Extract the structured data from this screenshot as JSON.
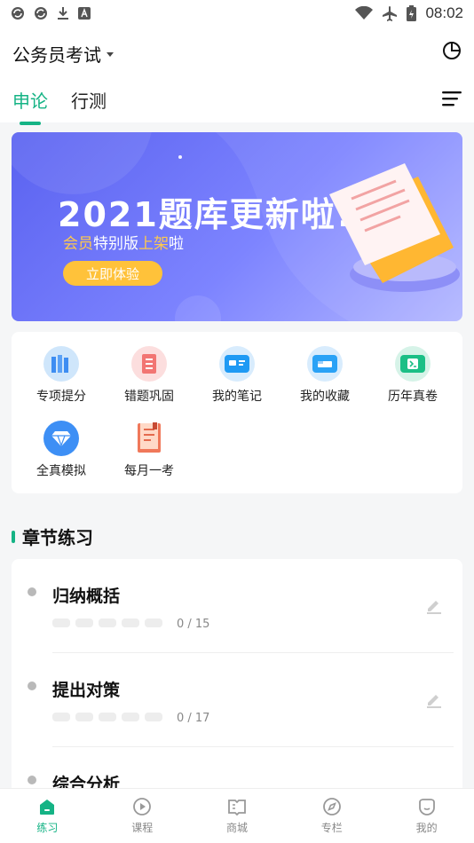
{
  "status_bar": {
    "time": "08:02",
    "icons_left": [
      "sync-icon",
      "sync-icon",
      "download-icon",
      "a-icon"
    ],
    "icons_right": [
      "wifi-icon",
      "airplane-icon",
      "battery-icon"
    ]
  },
  "header": {
    "exam_title": "公务员考试",
    "tabs": [
      {
        "label": "申论",
        "active": true
      },
      {
        "label": "行测",
        "active": false
      }
    ]
  },
  "banner": {
    "title": "2021题库更新啦!",
    "subtitle_parts": [
      "会员",
      "特别版",
      "上架",
      "啦"
    ],
    "cta": "立即体验"
  },
  "grid": {
    "items": [
      {
        "label": "专项提分",
        "icon": "books-icon"
      },
      {
        "label": "错题巩固",
        "icon": "error-book-icon"
      },
      {
        "label": "我的笔记",
        "icon": "notes-icon"
      },
      {
        "label": "我的收藏",
        "icon": "favorites-icon"
      },
      {
        "label": "历年真卷",
        "icon": "past-papers-icon"
      },
      {
        "label": "全真模拟",
        "icon": "diamond-icon"
      },
      {
        "label": "每月一考",
        "icon": "monthly-book-icon"
      }
    ]
  },
  "section": {
    "title": "章节练习"
  },
  "chapters": [
    {
      "name": "归纳概括",
      "count": "0 / 15",
      "progress": 0
    },
    {
      "name": "提出对策",
      "count": "0 / 17",
      "progress": 0
    },
    {
      "name": "综合分析",
      "count": "",
      "progress": 0
    }
  ],
  "tabbar": {
    "items": [
      {
        "label": "练习",
        "icon": "home-icon",
        "active": true
      },
      {
        "label": "课程",
        "icon": "play-icon",
        "active": false
      },
      {
        "label": "商城",
        "icon": "store-book-icon",
        "active": false
      },
      {
        "label": "专栏",
        "icon": "compass-icon",
        "active": false
      },
      {
        "label": "我的",
        "icon": "profile-icon",
        "active": false
      }
    ]
  },
  "colors": {
    "accent": "#15b385",
    "banner_start": "#5a62f0",
    "banner_end": "#b3b7ff",
    "cta": "#ffc23a"
  }
}
